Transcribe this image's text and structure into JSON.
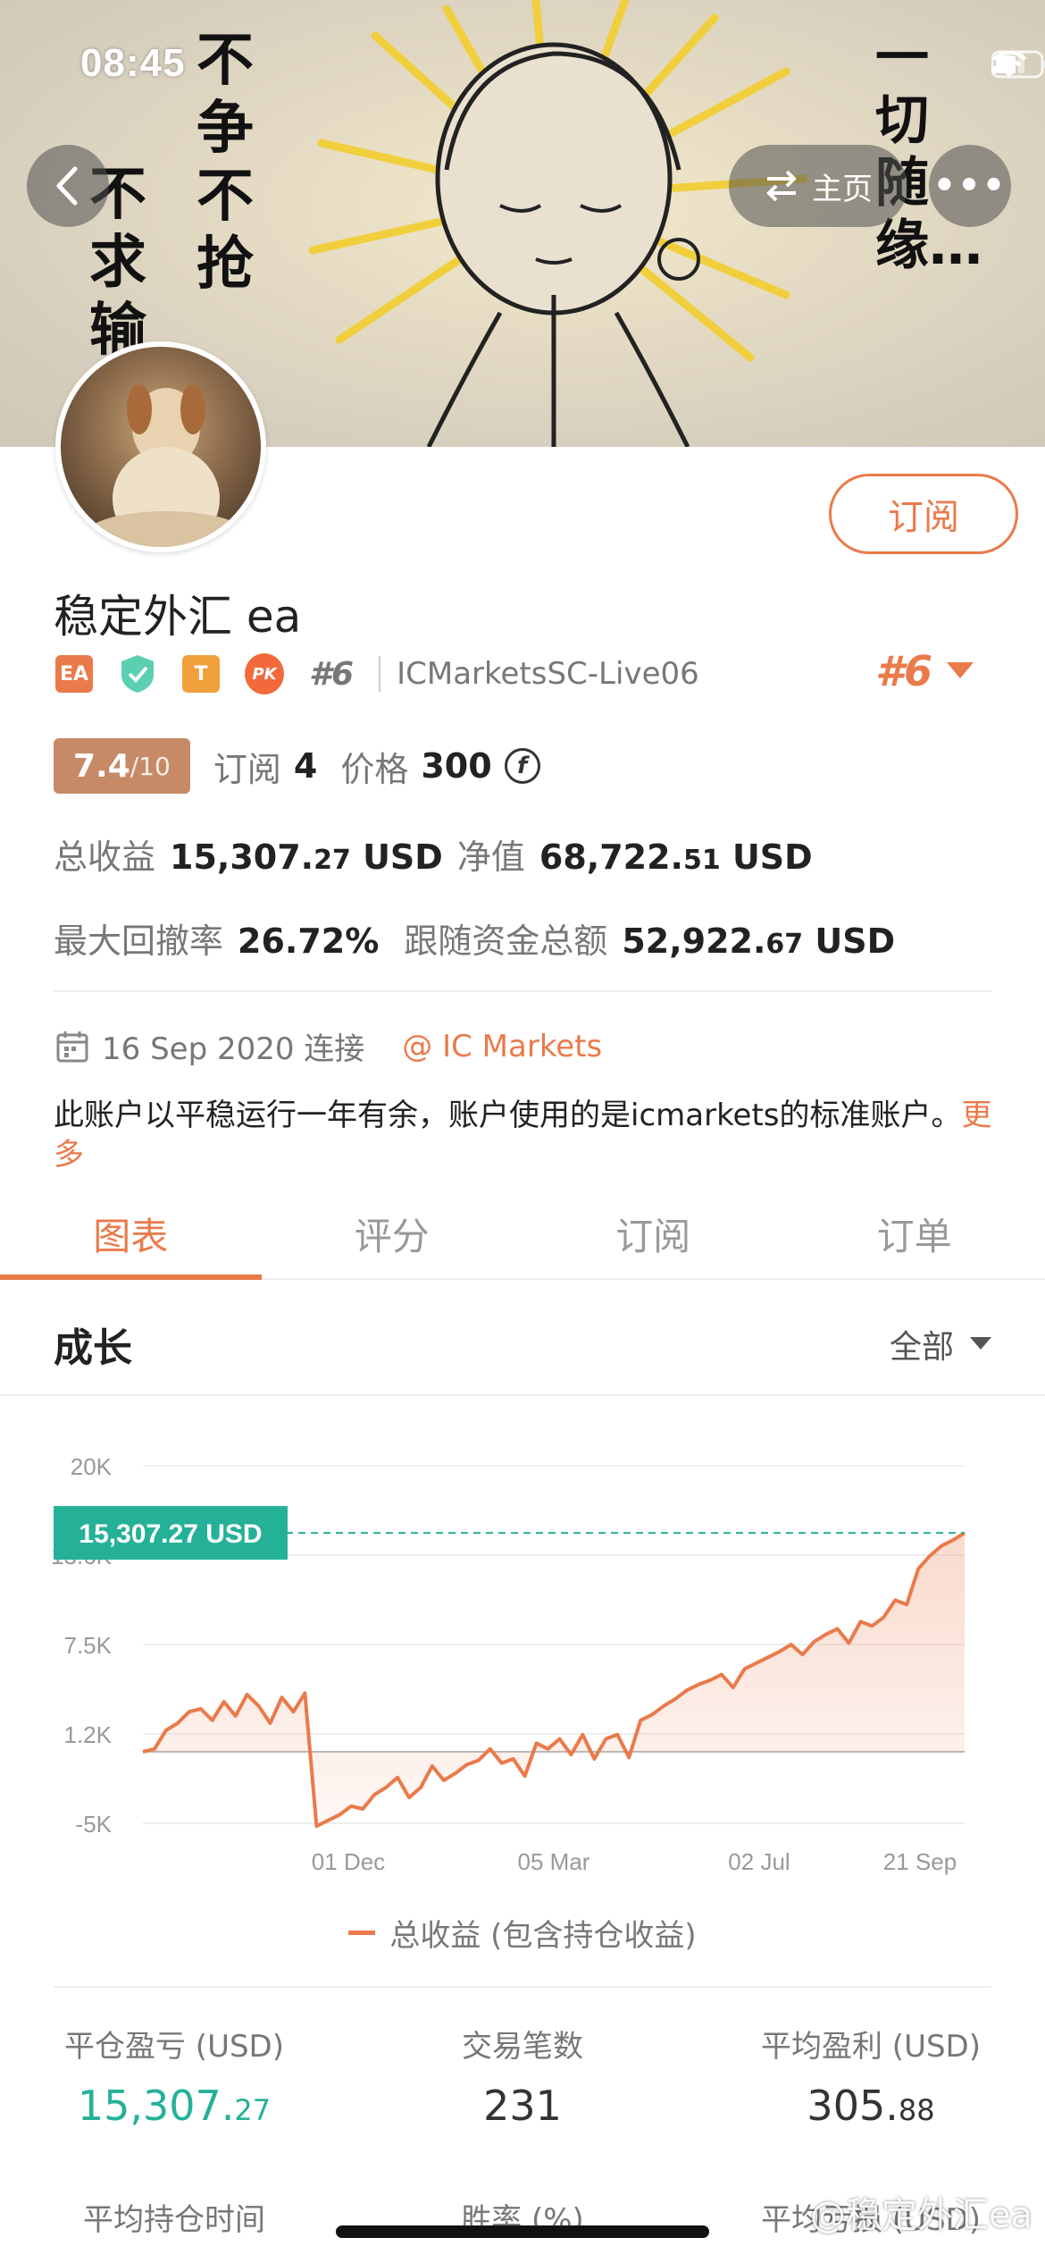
{
  "status": {
    "time": "08:45"
  },
  "banner": {
    "text_left_1": "不争不抢",
    "text_left_2": "不求输",
    "text_right": "一切随缘…"
  },
  "nav": {
    "home_label": "主页"
  },
  "profile": {
    "subscribe_label": "订阅",
    "name": "稳定外汇 ea",
    "badge_ea": "EA",
    "badge_t": "T",
    "badge_pk": "PK",
    "rank_small": "#6",
    "server": "ICMarketsSC-Live06",
    "rank_big": "#6",
    "score_main": "7.4",
    "score_den": "/10",
    "subs_label": "订阅",
    "subs_value": "4",
    "price_label": "价格",
    "price_value": "300",
    "price_currency_symbol": "f"
  },
  "stats": {
    "total_profit_label": "总收益",
    "total_profit_int": "15,307.",
    "total_profit_dec": "27",
    "total_profit_unit": "USD",
    "equity_label": "净值",
    "equity_int": "68,722.",
    "equity_dec": "51",
    "equity_unit": "USD",
    "max_dd_label": "最大回撤率",
    "max_dd_value": "26.72%",
    "follow_label": "跟随资金总额",
    "follow_int": "52,922.",
    "follow_dec": "67",
    "follow_unit": "USD"
  },
  "connect": {
    "date": "16 Sep 2020 连接",
    "broker": "@ IC Markets",
    "description": "此账户以平稳运行一年有余，账户使用的是icmarkets的标准账户。",
    "more": "更多"
  },
  "tabs": [
    "图表",
    "评分",
    "订阅",
    "订单"
  ],
  "section": {
    "title": "成长",
    "filter": "全部"
  },
  "chart_data": {
    "type": "area",
    "yticks": [
      "20K",
      "13.6K",
      "7.5K",
      "1.2K",
      "-5K"
    ],
    "xticks": [
      "01 Dec",
      "05 Mar",
      "02 Jul",
      "21 Sep"
    ],
    "ylim": [
      -5000,
      20000
    ],
    "current_label": "15,307.27 USD",
    "current_value": 15307.27,
    "legend": "总收益 (包含持仓收益)",
    "series": [
      {
        "name": "总收益 (包含持仓收益)",
        "values": [
          0,
          200,
          1500,
          2000,
          2800,
          3000,
          2200,
          3500,
          2500,
          4000,
          3200,
          2000,
          3800,
          2800,
          4100,
          -5200,
          -4800,
          -4400,
          -3800,
          -4000,
          -3000,
          -2500,
          -1800,
          -3200,
          -2500,
          -1000,
          -2000,
          -1500,
          -900,
          -600,
          200,
          -800,
          -500,
          -1700,
          600,
          200,
          900,
          -200,
          1200,
          -500,
          900,
          1200,
          -400,
          2200,
          2600,
          3200,
          3700,
          4300,
          4700,
          5000,
          5400,
          4500,
          5800,
          6200,
          6600,
          7000,
          7500,
          6800,
          7700,
          8200,
          8600,
          7600,
          9100,
          8800,
          9400,
          10600,
          10300,
          12800,
          13700,
          14400,
          14800,
          15307
        ]
      }
    ]
  },
  "metrics": [
    {
      "label": "平仓盈亏 (USD)",
      "int": "15,307.",
      "dec": "27",
      "green": true
    },
    {
      "label": "交易笔数",
      "int": "231",
      "dec": "",
      "green": false
    },
    {
      "label": "平均盈利 (USD)",
      "int": "305.",
      "dec": "88",
      "green": false
    }
  ],
  "metrics2": [
    "平均持仓时间",
    "胜率 (%)",
    "平均亏损 (USD)"
  ],
  "watermark": "@稳定外汇ea",
  "colors": {
    "accent": "#ea7a4a",
    "green": "#25b198"
  }
}
